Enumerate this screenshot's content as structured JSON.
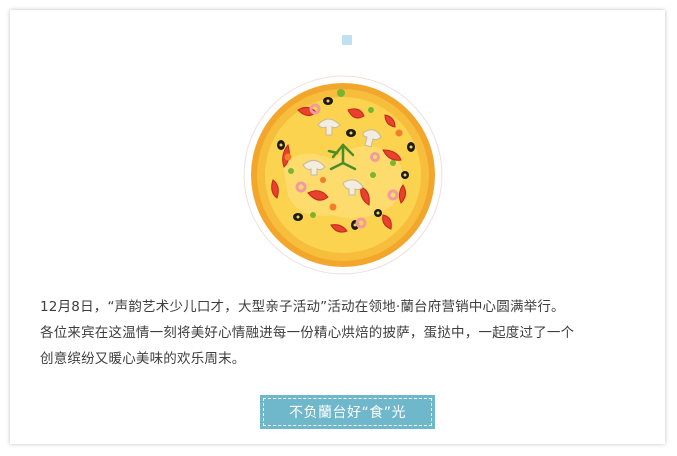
{
  "article": {
    "paragraph_lines": [
      "12月8日，“声韵艺术少儿口才，大型亲子活动”活动在领地·蘭台府营销中心圆满举行。",
      "各位来宾在这温情一刻将美好心情融进每一份精心烘焙的披萨，蛋挞中，一起度过了一个",
      "创意缤纷又暖心美味的欢乐周末。"
    ],
    "tag_label": "不负蘭台好“食”光"
  },
  "image": {
    "subject": "pizza-illustration"
  },
  "colors": {
    "accent": "#6fb7cb",
    "marker": "#bfe1f3",
    "text": "#3e3e3e"
  }
}
